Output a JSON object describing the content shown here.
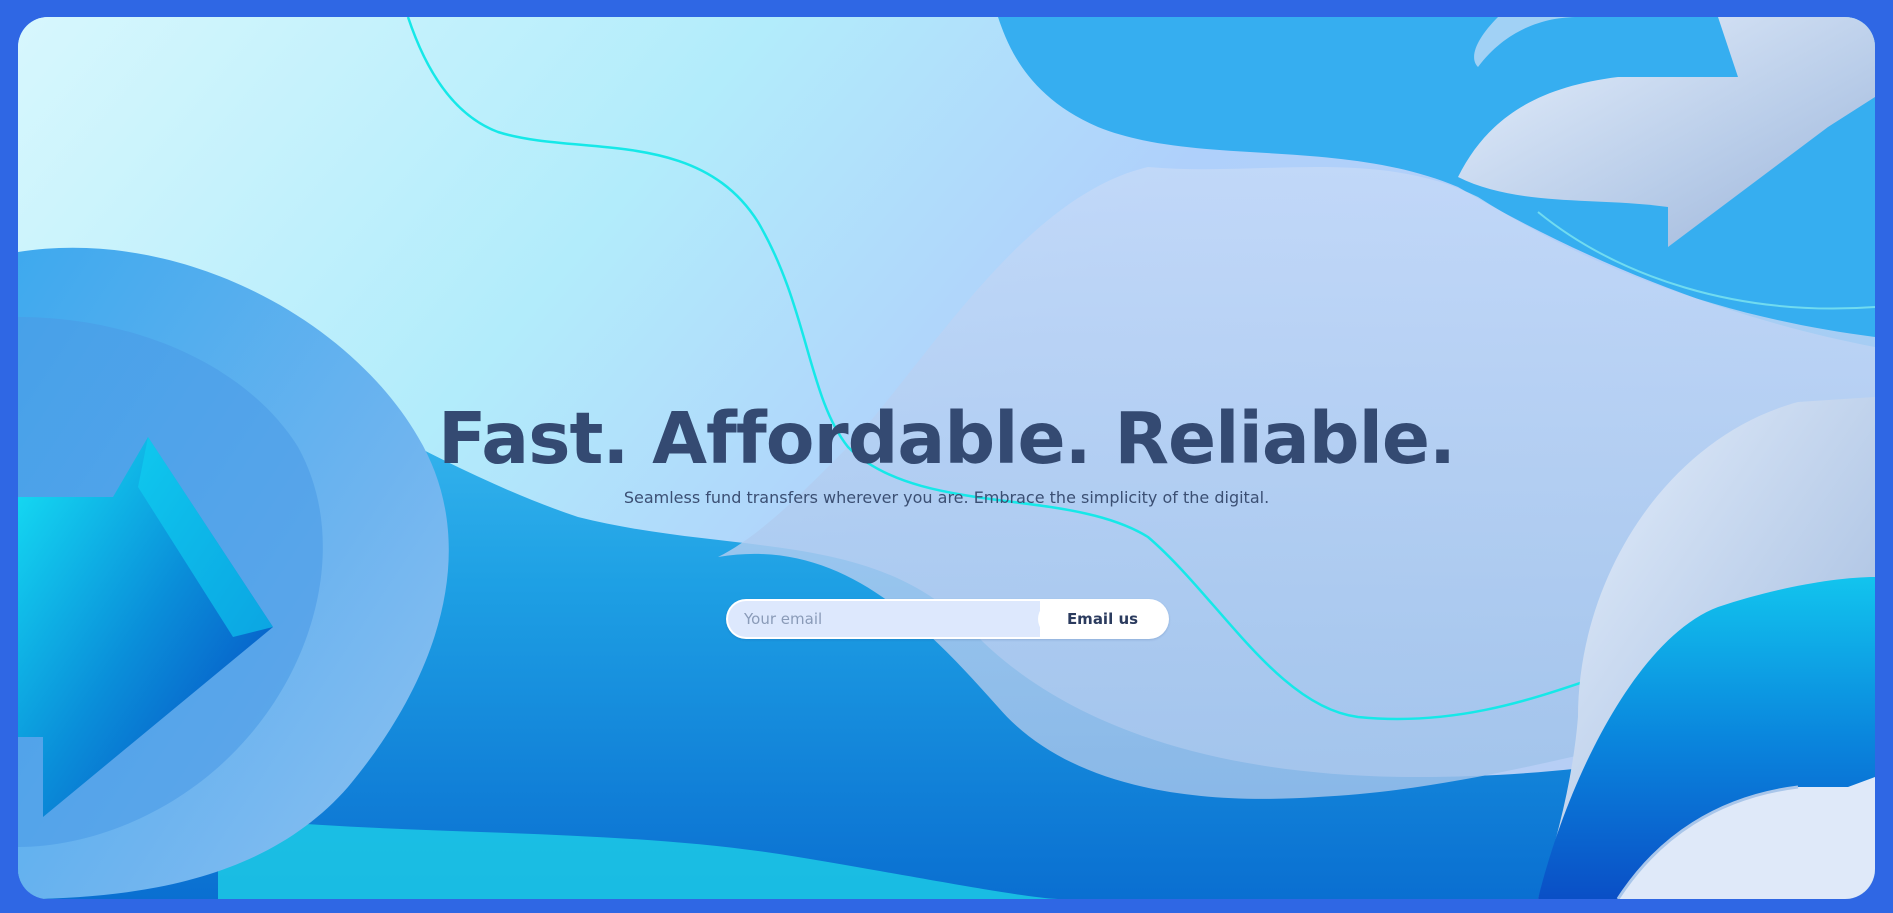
{
  "hero": {
    "headline": "Fast. Affordable. Reliable.",
    "subheadline": "Seamless fund transfers wherever you are. Embrace the simplicity of the digital."
  },
  "email_form": {
    "placeholder": "Your email",
    "value": "",
    "submit_label": "Email us"
  },
  "colors": {
    "page_border": "#2f67e4",
    "headline": "#344a72",
    "subheadline": "#3b4f73",
    "input_fill": "#dde8fd",
    "button_fill": "#ffffff",
    "button_text": "#2b3b5e"
  },
  "decorations": {
    "left_shape": "arrow-ring-icon",
    "right_top_shape": "arrow-icon",
    "right_bottom_shape": "arrow-icon"
  }
}
